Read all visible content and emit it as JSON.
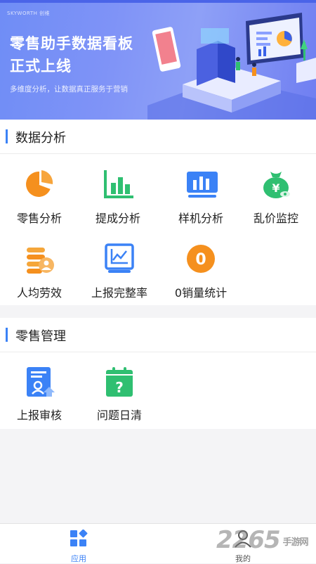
{
  "banner": {
    "brand": "SKYWORTH 创维",
    "title_line1": "零售助手数据看板",
    "title_line2": "正式上线",
    "subtitle": "多维度分析，让数据真正服务于营销"
  },
  "sections": [
    {
      "title": "数据分析",
      "items": [
        {
          "label": "零售分析",
          "icon": "pie-chart-icon"
        },
        {
          "label": "提成分析",
          "icon": "bar-chart-icon"
        },
        {
          "label": "样机分析",
          "icon": "sample-chart-icon"
        },
        {
          "label": "乱价监控",
          "icon": "money-bag-icon"
        },
        {
          "label": "人均劳效",
          "icon": "coins-user-icon"
        },
        {
          "label": "上报完整率",
          "icon": "line-chart-icon"
        },
        {
          "label": "0销量统计",
          "icon": "zero-badge-icon",
          "badge_text": "0"
        }
      ]
    },
    {
      "title": "零售管理",
      "items": [
        {
          "label": "上报审核",
          "icon": "report-review-icon"
        },
        {
          "label": "问题日清",
          "icon": "calendar-question-icon",
          "badge_text": "?"
        }
      ]
    }
  ],
  "bottom_nav": {
    "items": [
      {
        "label": "应用",
        "icon": "apps-icon",
        "active": true
      },
      {
        "label": "我的",
        "icon": "user-icon",
        "active": false
      }
    ]
  },
  "watermark": {
    "text": "2265",
    "suffix": "手游网"
  },
  "colors": {
    "accent": "#3b82f6",
    "orange": "#f5901e",
    "green": "#2fbf71",
    "banner": "#7b8ff5"
  }
}
